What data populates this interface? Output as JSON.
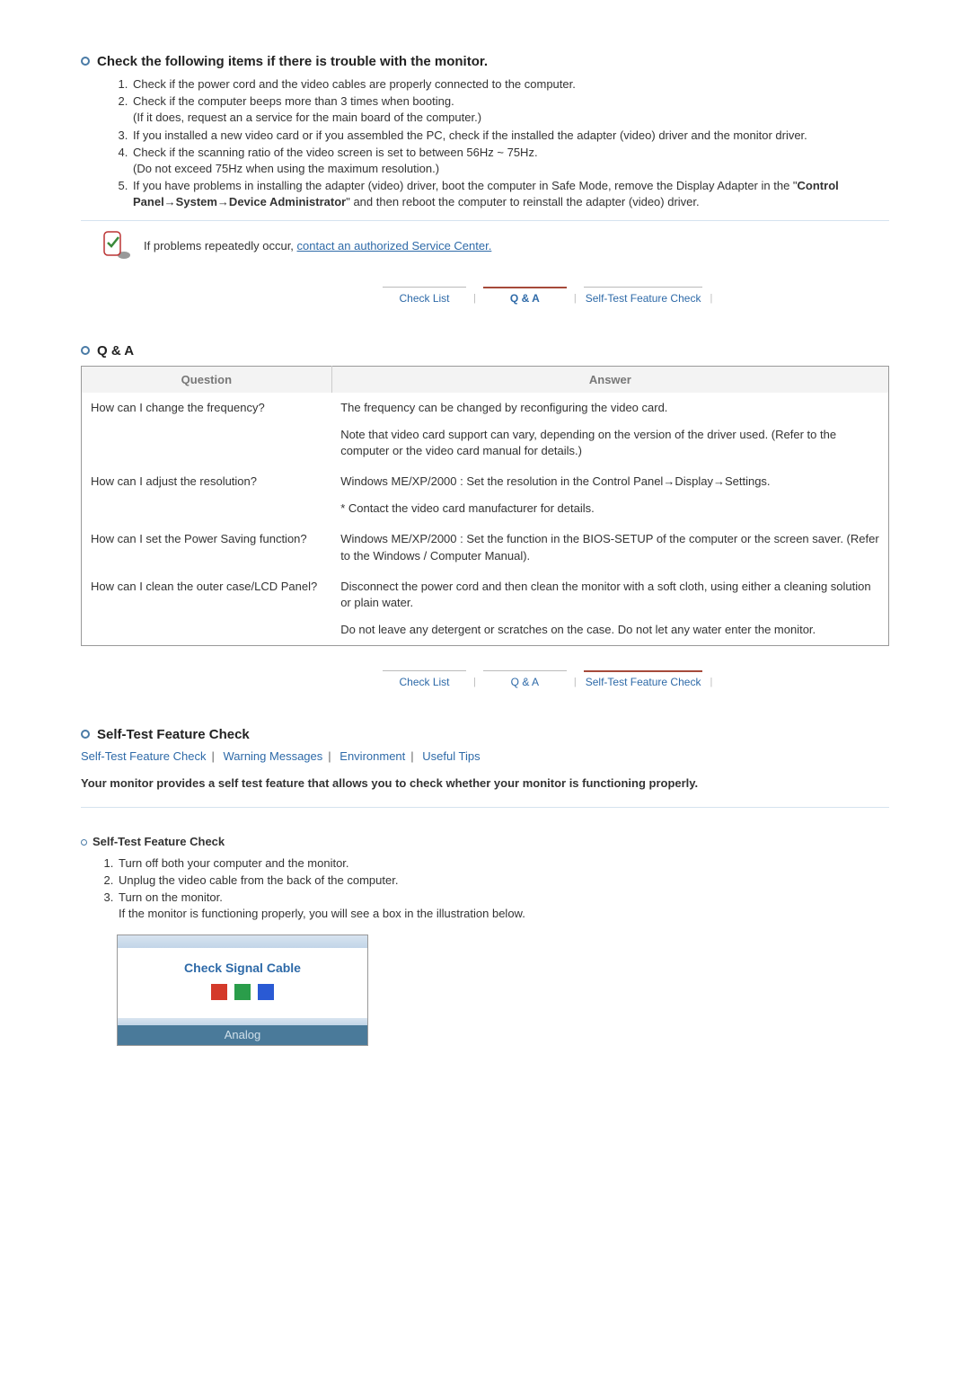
{
  "section1": {
    "title": "Check the following items if there is trouble with the monitor.",
    "items": [
      "Check if the power cord and the video cables are properly connected to the computer.",
      "Check if the computer beeps more than 3 times when booting.",
      "If you installed a new video card or if you assembled the PC, check if the installed the adapter (video) driver and the monitor driver.",
      "Check if the scanning ratio of the video screen is set to between 56Hz ~ 75Hz.",
      "If you have problems in installing the adapter (video) driver, boot the computer in Safe Mode, remove the Display Adapter in the \"Control Panel→System→Device Administrator\" and then reboot the computer to reinstall the adapter (video) driver."
    ],
    "item2_sub": "(If it does, request an a service for the main board of the computer.)",
    "item4_sub": "(Do not exceed 75Hz when using the maximum resolution.)",
    "item5_bold": "Control Panel→System→Device Administrator",
    "note_prefix": "If problems repeatedly occur, ",
    "note_link": "contact an authorized Service Center."
  },
  "tabs": {
    "check_list": "Check List",
    "qa": "Q & A",
    "self_test": "Self-Test Feature Check"
  },
  "section2": {
    "title": "Q & A",
    "th_question": "Question",
    "th_answer": "Answer",
    "rows": [
      {
        "q": "How can I change the frequency?",
        "a1": "The frequency can be changed by reconfiguring the video card.",
        "a2": "Note that video card support can vary, depending on the version of the driver used. (Refer to the computer or the video card manual for details.)"
      },
      {
        "q": "How can I adjust the resolution?",
        "a1": "Windows ME/XP/2000 : Set the resolution in the Control Panel→Display→Settings.",
        "a2": "* Contact the video card manufacturer for details."
      },
      {
        "q": "How can I set the Power Saving function?",
        "a1": "Windows ME/XP/2000 : Set the function in the BIOS-SETUP of the computer or the screen saver. (Refer to the Windows / Computer Manual)."
      },
      {
        "q": "How can I clean the outer case/LCD Panel?",
        "a1": "Disconnect the power cord and then clean the monitor with a soft cloth, using either a cleaning solution or plain water.",
        "a2": "Do not leave any detergent or scratches on the case. Do not let any water enter the monitor."
      }
    ]
  },
  "section3": {
    "title": "Self-Test Feature Check",
    "links": {
      "selftest": "Self-Test Feature Check",
      "warning": "Warning Messages",
      "env": "Environment",
      "tips": "Useful Tips"
    },
    "intro": "Your monitor provides a self test feature that allows you to check whether your monitor is functioning properly.",
    "sub_heading": "Self-Test Feature Check",
    "steps": [
      "Turn off both your computer and the monitor.",
      "Unplug the video cable from the back of the computer.",
      "Turn on the monitor."
    ],
    "step3_sub": "If the monitor is functioning properly, you will see a box in the illustration below.",
    "monitor_msg": "Check Signal Cable",
    "monitor_mode": "Analog"
  }
}
